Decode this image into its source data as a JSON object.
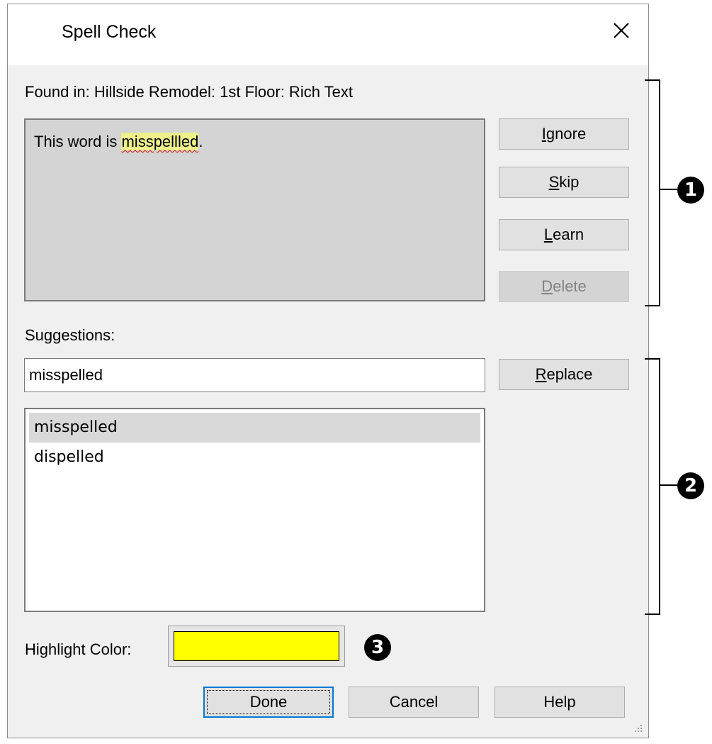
{
  "dialog": {
    "title": "Spell Check",
    "found_in": "Found in: Hillside Remodel:  1st Floor: Rich Text",
    "preview": {
      "prefix": "This word is ",
      "misspelled_word": "misspellled",
      "suffix": "."
    }
  },
  "actions": {
    "ignore": {
      "mnemonic": "I",
      "rest": "gnore"
    },
    "skip": {
      "mnemonic": "S",
      "rest": "kip"
    },
    "learn": {
      "mnemonic": "L",
      "rest": "earn"
    },
    "delete": {
      "mnemonic": "D",
      "rest": "elete"
    },
    "replace": {
      "mnemonic": "R",
      "rest": "eplace"
    }
  },
  "suggestions": {
    "label": "Suggestions:",
    "input_value": "misspelled",
    "items": [
      "misspelled",
      "dispelled"
    ],
    "selected_index": 0
  },
  "highlight": {
    "label": "Highlight Color:",
    "color": "#ffff00"
  },
  "footer": {
    "done": "Done",
    "cancel": "Cancel",
    "help": "Help"
  },
  "callouts": {
    "one": "1",
    "two": "2",
    "three": "3"
  },
  "colors": {
    "default_button_border": "#0078d7",
    "word_highlight": "#eef08a",
    "squiggle": "#d80000"
  }
}
